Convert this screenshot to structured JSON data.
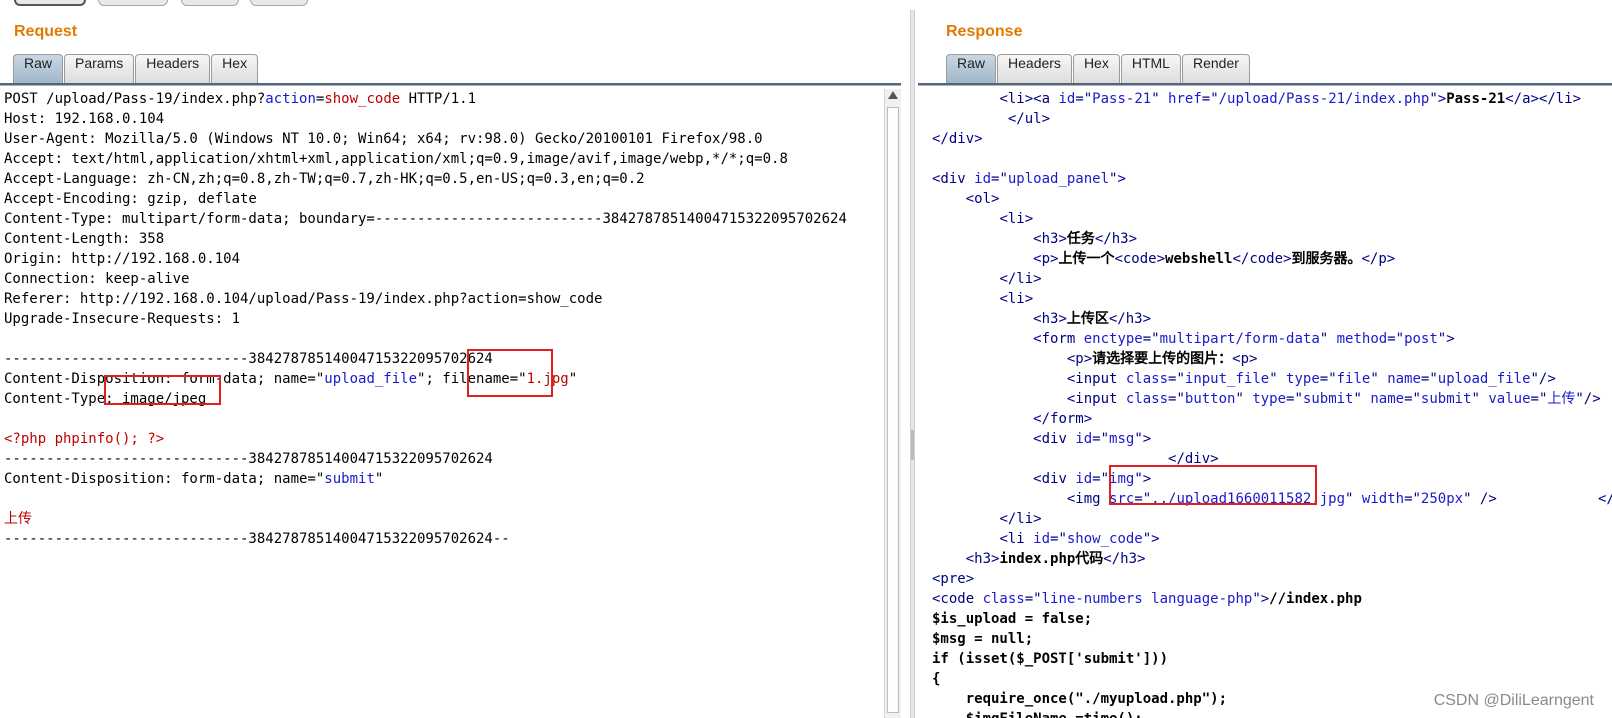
{
  "request": {
    "title": "Request",
    "tabs": [
      "Raw",
      "Params",
      "Headers",
      "Hex"
    ],
    "active_tab": "Raw",
    "lines": [
      [
        [
          "t",
          "POST /upload/Pass-19/index.php?"
        ],
        [
          "s",
          "action"
        ],
        [
          "t",
          "="
        ],
        [
          "k",
          "show_code"
        ],
        [
          "t",
          " HTTP/1.1"
        ]
      ],
      [
        [
          "t",
          "Host: 192.168.0.104"
        ]
      ],
      [
        [
          "t",
          "User-Agent: Mozilla/5.0 (Windows NT 10.0; Win64; x64; rv:98.0) Gecko/20100101 Firefox/98.0"
        ]
      ],
      [
        [
          "t",
          "Accept: text/html,application/xhtml+xml,application/xml;q=0.9,image/avif,image/webp,*/*;q=0.8"
        ]
      ],
      [
        [
          "t",
          "Accept-Language: zh-CN,zh;q=0.8,zh-TW;q=0.7,zh-HK;q=0.5,en-US;q=0.3,en;q=0.2"
        ]
      ],
      [
        [
          "t",
          "Accept-Encoding: gzip, deflate"
        ]
      ],
      [
        [
          "t",
          "Content-Type: multipart/form-data; boundary=---------------------------38427878514004715322095702624"
        ]
      ],
      [
        [
          "t",
          "Content-Length: 358"
        ]
      ],
      [
        [
          "t",
          "Origin: http://192.168.0.104"
        ]
      ],
      [
        [
          "t",
          "Connection: keep-alive"
        ]
      ],
      [
        [
          "t",
          "Referer: http://192.168.0.104/upload/Pass-19/index.php?action=show_code"
        ]
      ],
      [
        [
          "t",
          "Upgrade-Insecure-Requests: 1"
        ]
      ],
      [
        [
          "t",
          ""
        ]
      ],
      [
        [
          "t",
          "-----------------------------38427878514004715322095702624"
        ]
      ],
      [
        [
          "t",
          "Content-Disposition: form-data; name=\""
        ],
        [
          "s",
          "upload_file"
        ],
        [
          "t",
          "\"; filename=\""
        ],
        [
          "k",
          "1.jpg"
        ],
        [
          "t",
          "\""
        ]
      ],
      [
        [
          "t",
          "Content-Type: image/jpeg"
        ]
      ],
      [
        [
          "t",
          ""
        ]
      ],
      [
        [
          "p",
          "<?php phpinfo(); ?>"
        ]
      ],
      [
        [
          "t",
          "-----------------------------38427878514004715322095702624"
        ]
      ],
      [
        [
          "t",
          "Content-Disposition: form-data; name=\""
        ],
        [
          "s",
          "submit"
        ],
        [
          "t",
          "\""
        ]
      ],
      [
        [
          "t",
          ""
        ]
      ],
      [
        [
          "p",
          "上传"
        ]
      ],
      [
        [
          "t",
          "-----------------------------38427878514004715322095702624--"
        ]
      ]
    ]
  },
  "response": {
    "title": "Response",
    "tabs": [
      "Raw",
      "Headers",
      "Hex",
      "HTML",
      "Render"
    ],
    "active_tab": "Raw",
    "lines": [
      [
        [
          "t",
          "        "
        ],
        [
          "g",
          "<li><a "
        ],
        [
          "a",
          "id"
        ],
        [
          "g",
          "=\""
        ],
        [
          "s",
          "Pass-21"
        ],
        [
          "g",
          "\" "
        ],
        [
          "a",
          "href"
        ],
        [
          "g",
          "=\""
        ],
        [
          "s",
          "/upload/Pass-21/index.php"
        ],
        [
          "g",
          "\">"
        ],
        [
          "b",
          "Pass-21"
        ],
        [
          "g",
          "</a></li>"
        ]
      ],
      [
        [
          "t",
          "         "
        ],
        [
          "g",
          "</ul>"
        ]
      ],
      [
        [
          "g",
          "</div>"
        ]
      ],
      [
        [
          "t",
          ""
        ]
      ],
      [
        [
          "g",
          "<div "
        ],
        [
          "a",
          "id"
        ],
        [
          "g",
          "=\""
        ],
        [
          "s",
          "upload_panel"
        ],
        [
          "g",
          "\">"
        ]
      ],
      [
        [
          "t",
          "    "
        ],
        [
          "g",
          "<ol>"
        ]
      ],
      [
        [
          "t",
          "        "
        ],
        [
          "g",
          "<li>"
        ]
      ],
      [
        [
          "t",
          "            "
        ],
        [
          "g",
          "<h3>"
        ],
        [
          "b",
          "任务"
        ],
        [
          "g",
          "</h3>"
        ]
      ],
      [
        [
          "t",
          "            "
        ],
        [
          "g",
          "<p>"
        ],
        [
          "b",
          "上传一个"
        ],
        [
          "g",
          "<code>"
        ],
        [
          "b",
          "webshell"
        ],
        [
          "g",
          "</code>"
        ],
        [
          "b",
          "到服务器。"
        ],
        [
          "g",
          "</p>"
        ]
      ],
      [
        [
          "t",
          "        "
        ],
        [
          "g",
          "</li>"
        ]
      ],
      [
        [
          "t",
          "        "
        ],
        [
          "g",
          "<li>"
        ]
      ],
      [
        [
          "t",
          "            "
        ],
        [
          "g",
          "<h3>"
        ],
        [
          "b",
          "上传区"
        ],
        [
          "g",
          "</h3>"
        ]
      ],
      [
        [
          "t",
          "            "
        ],
        [
          "g",
          "<form "
        ],
        [
          "a",
          "enctype"
        ],
        [
          "g",
          "=\""
        ],
        [
          "s",
          "multipart/form-data"
        ],
        [
          "g",
          "\" "
        ],
        [
          "a",
          "method"
        ],
        [
          "g",
          "=\""
        ],
        [
          "s",
          "post"
        ],
        [
          "g",
          "\">"
        ]
      ],
      [
        [
          "t",
          "                "
        ],
        [
          "g",
          "<p>"
        ],
        [
          "b",
          "请选择要上传的图片："
        ],
        [
          "g",
          "<p>"
        ]
      ],
      [
        [
          "t",
          "                "
        ],
        [
          "g",
          "<input "
        ],
        [
          "a",
          "class"
        ],
        [
          "g",
          "=\""
        ],
        [
          "s",
          "input_file"
        ],
        [
          "g",
          "\" "
        ],
        [
          "a",
          "type"
        ],
        [
          "g",
          "=\""
        ],
        [
          "s",
          "file"
        ],
        [
          "g",
          "\" "
        ],
        [
          "a",
          "name"
        ],
        [
          "g",
          "=\""
        ],
        [
          "s",
          "upload_file"
        ],
        [
          "g",
          "\"/>"
        ]
      ],
      [
        [
          "t",
          "                "
        ],
        [
          "g",
          "<input "
        ],
        [
          "a",
          "class"
        ],
        [
          "g",
          "=\""
        ],
        [
          "s",
          "button"
        ],
        [
          "g",
          "\" "
        ],
        [
          "a",
          "type"
        ],
        [
          "g",
          "=\""
        ],
        [
          "s",
          "submit"
        ],
        [
          "g",
          "\" "
        ],
        [
          "a",
          "name"
        ],
        [
          "g",
          "=\""
        ],
        [
          "s",
          "submit"
        ],
        [
          "g",
          "\" "
        ],
        [
          "a",
          "value"
        ],
        [
          "g",
          "=\""
        ],
        [
          "s",
          "上传"
        ],
        [
          "g",
          "\"/>"
        ]
      ],
      [
        [
          "t",
          "            "
        ],
        [
          "g",
          "</form>"
        ]
      ],
      [
        [
          "t",
          "            "
        ],
        [
          "g",
          "<div "
        ],
        [
          "a",
          "id"
        ],
        [
          "g",
          "=\""
        ],
        [
          "s",
          "msg"
        ],
        [
          "g",
          "\">"
        ]
      ],
      [
        [
          "t",
          "                "
        ],
        [
          "t",
          "            "
        ],
        [
          "g",
          "</div>"
        ]
      ],
      [
        [
          "t",
          "            "
        ],
        [
          "g",
          "<div "
        ],
        [
          "a",
          "id"
        ],
        [
          "g",
          "=\""
        ],
        [
          "s",
          "img"
        ],
        [
          "g",
          "\">"
        ]
      ],
      [
        [
          "t",
          "                "
        ],
        [
          "g",
          "<img "
        ],
        [
          "a",
          "src"
        ],
        [
          "g",
          "=\""
        ],
        [
          "s",
          "../upload1660011582.jpg"
        ],
        [
          "g",
          "\" "
        ],
        [
          "a",
          "width"
        ],
        [
          "g",
          "=\""
        ],
        [
          "s",
          "250px"
        ],
        [
          "g",
          "\" />"
        ],
        [
          "t",
          "            "
        ],
        [
          "g",
          "</div>"
        ]
      ],
      [
        [
          "t",
          "        "
        ],
        [
          "g",
          "</li>"
        ]
      ],
      [
        [
          "t",
          "        "
        ],
        [
          "g",
          "<li "
        ],
        [
          "a",
          "id"
        ],
        [
          "g",
          "=\""
        ],
        [
          "s",
          "show_code"
        ],
        [
          "g",
          "\">"
        ]
      ],
      [
        [
          "t",
          "    "
        ],
        [
          "g",
          "<h3>"
        ],
        [
          "b",
          "index.php代码"
        ],
        [
          "g",
          "</h3>"
        ]
      ],
      [
        [
          "g",
          "<pre>"
        ]
      ],
      [
        [
          "g",
          "<code "
        ],
        [
          "a",
          "class"
        ],
        [
          "g",
          "=\""
        ],
        [
          "s",
          "line-numbers language-php"
        ],
        [
          "g",
          "\">"
        ],
        [
          "b",
          "//index.php"
        ]
      ],
      [
        [
          "b",
          "$is_upload = false;"
        ]
      ],
      [
        [
          "b",
          "$msg = null;"
        ]
      ],
      [
        [
          "b",
          "if (isset($_POST['submit']))"
        ]
      ],
      [
        [
          "b",
          "{"
        ]
      ],
      [
        [
          "b",
          "    require_once(\"./myupload.php\");"
        ]
      ],
      [
        [
          "b",
          "    $imgFileName =time();"
        ]
      ]
    ]
  },
  "watermark": "CSDN @DiliLearngent",
  "colors": {
    "title": "#e07b00",
    "highlight": "#e02020",
    "string": "#1a1acc",
    "keyword": "#c00000",
    "tag": "#000080"
  }
}
